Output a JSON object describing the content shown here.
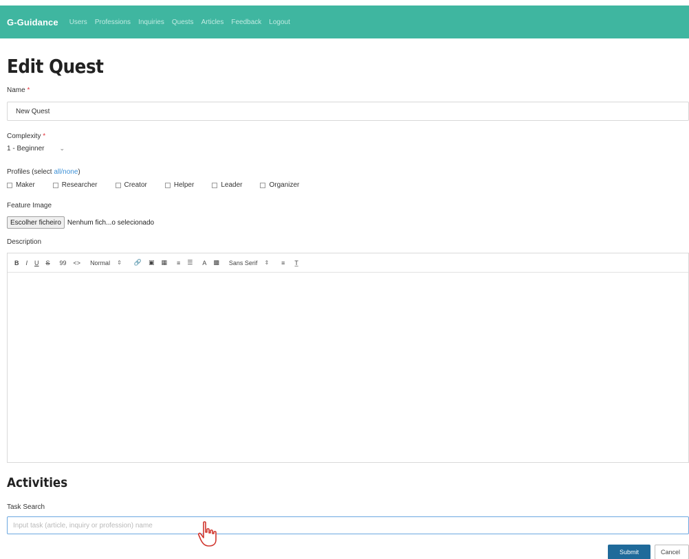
{
  "nav": {
    "brand": "G-Guidance",
    "links": [
      "Users",
      "Professions",
      "Inquiries",
      "Quests",
      "Articles",
      "Feedback",
      "Logout"
    ]
  },
  "page": {
    "title": "Edit Quest"
  },
  "form": {
    "name_label": "Name",
    "required_mark": "*",
    "name_value": "New Quest",
    "complexity_label": "Complexity",
    "complexity_value": "1 - Beginner",
    "profiles_label_prefix": "Profiles (select ",
    "profiles_all_link": "all",
    "profiles_separator": "/",
    "profiles_none_link": "none",
    "profiles_label_suffix": ")",
    "profiles": [
      "Maker",
      "Researcher",
      "Creator",
      "Helper",
      "Leader",
      "Organizer"
    ],
    "feature_image_label": "Feature Image",
    "file_button_label": "Escolher ficheiro",
    "file_status": "Nenhum fich...o selecionado",
    "description_label": "Description",
    "editor_toolbar": {
      "bold": "B",
      "italic": "I",
      "underline": "U",
      "strike": "S",
      "quote": "99",
      "code": "<>",
      "header_select": "Normal",
      "font_select": "Sans Serif",
      "select_caret": "⇕"
    }
  },
  "activities": {
    "title": "Activities",
    "task_search_label": "Task Search",
    "task_search_placeholder": "Input task (article, inquiry or profession) name"
  },
  "actions": {
    "submit_label": "Submit",
    "cancel_label": "Cancel"
  },
  "colors": {
    "nav_bg": "#3fb6a0",
    "submit_bg": "#1f6a9a",
    "required": "#e2323a",
    "link": "#3a8fd6"
  }
}
